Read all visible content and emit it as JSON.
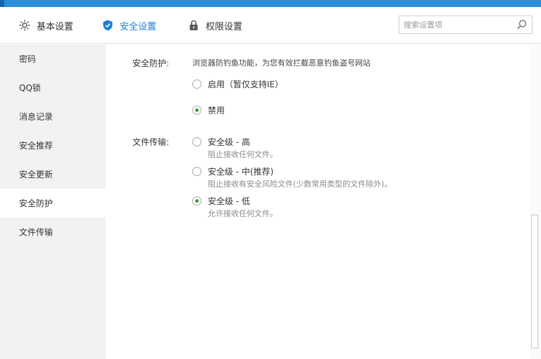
{
  "tabs": {
    "basic": "基本设置",
    "security": "安全设置",
    "permission": "权限设置"
  },
  "search": {
    "placeholder": "搜索设置项"
  },
  "sidebar": {
    "items": [
      "密码",
      "QQ锁",
      "消息记录",
      "安全推荐",
      "安全更新",
      "安全防护",
      "文件传输"
    ],
    "active_index": 5
  },
  "protection": {
    "label": "安全防护:",
    "description": "浏览器防钓鱼功能，为您有效拦截恶意钓鱼盗号网站",
    "options": [
      {
        "label": "启用（暂仅支持IE）",
        "checked": false
      },
      {
        "label": "禁用",
        "checked": true
      }
    ]
  },
  "transfer": {
    "label": "文件传输:",
    "options": [
      {
        "label": "安全级 - 高",
        "sub": "阻止接收任何文件。",
        "checked": false
      },
      {
        "label": "安全级 - 中(推荐)",
        "sub": "阻止接收有安全风险文件(少数常用类型的文件除外)。",
        "checked": false
      },
      {
        "label": "安全级 - 低",
        "sub": "允许接收任何文件。",
        "checked": true
      }
    ]
  },
  "colors": {
    "accent": "#1e7fd6",
    "titlebar": "#2a8fd8",
    "radio_checked": "#3d9b3d",
    "sidebar_bg": "#f2f2f2"
  },
  "icons": {
    "basic": "gear-icon",
    "security": "shield-icon",
    "permission": "lock-icon",
    "search": "search-icon"
  }
}
